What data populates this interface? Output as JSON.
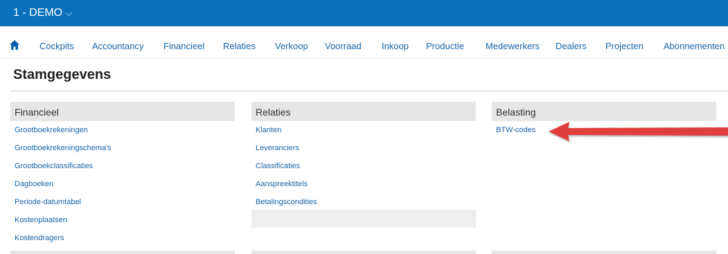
{
  "company": {
    "label": "1 - DEMO",
    "chevron": "⌵"
  },
  "menu": {
    "home_icon": "home-icon",
    "items": [
      "Cockpits",
      "Accountancy",
      "Financieel",
      "Relaties",
      "Verkoop",
      "Voorraad",
      "Inkoop",
      "Productie",
      "Medewerkers",
      "Dealers",
      "Projecten",
      "Abonnementen"
    ]
  },
  "page": {
    "title": "Stamgegevens"
  },
  "panels": {
    "financieel": {
      "title": "Financieel",
      "links": [
        "Grootboekrekeningen",
        "Grootboekrekeningschema's",
        "Grootboekclassificaties",
        "Dagboeken",
        "Periode-datumtabel",
        "Kostenplaatsen",
        "Kostendragers"
      ]
    },
    "relaties": {
      "title": "Relaties",
      "links": [
        "Klanten",
        "Leveranciers",
        "Classificaties",
        "Aanspreektitels",
        "Betalingscondities"
      ]
    },
    "belasting": {
      "title": "Belasting",
      "links": [
        "BTW-codes"
      ]
    }
  },
  "annotation": {
    "arrow_color": "#e03c3c"
  },
  "colors": {
    "topbar": "#0a71bd",
    "link": "#1565a8",
    "panel_header": "#e6e6e6"
  }
}
